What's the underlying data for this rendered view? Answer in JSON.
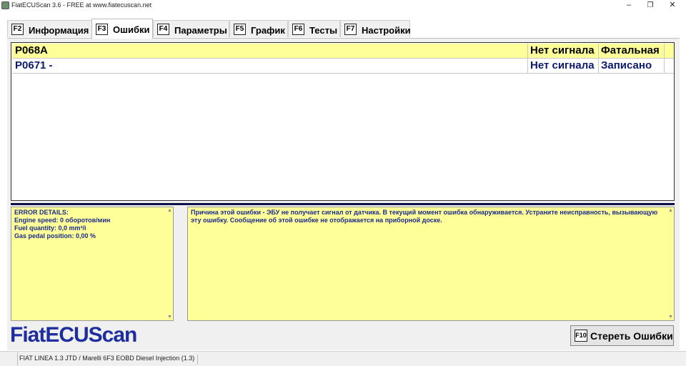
{
  "window": {
    "title": "FiatECUScan 3.6 - FREE at www.fiatecuscan.net",
    "minimize": "–",
    "restore": "❐",
    "close": "✕"
  },
  "tabs": [
    {
      "key": "F2",
      "label": "Информация"
    },
    {
      "key": "F3",
      "label": "Ошибки"
    },
    {
      "key": "F4",
      "label": "Параметры"
    },
    {
      "key": "F5",
      "label": "График"
    },
    {
      "key": "F6",
      "label": "Тесты"
    },
    {
      "key": "F7",
      "label": "Настройки"
    }
  ],
  "errors": [
    {
      "code": "P068A",
      "signal": "Нет сигнала",
      "status": "Фатальная"
    },
    {
      "code": "P0671 -",
      "signal": "Нет сигнала",
      "status": "Записано"
    }
  ],
  "details": {
    "text": "ERROR DETAILS:\nEngine speed: 0 оборотов/мин\nFuel quantity: 0,0 mm³/i\nGas pedal position: 0,00 %"
  },
  "description": {
    "text": "Причина этой ошибки - ЭБУ не получает сигнал от датчика. В текущий момент ошибка обнаруживается. Устраните неисправность, вызывающую эту ошибку. Сообщение об этой ошибке не отображается на приборной доске."
  },
  "logo": "FiatECUScan",
  "clear_button": {
    "key": "F10",
    "label": "Стереть Ошибки"
  },
  "status": {
    "vehicle": "FIAT LINEA 1.3 JTD / Marelli 6F3 EOBD Diesel Injection (1.3)"
  },
  "colors": {
    "highlight": "#ffff99",
    "logo": "#1f2e9e",
    "text_blue": "#1a2a8a"
  }
}
